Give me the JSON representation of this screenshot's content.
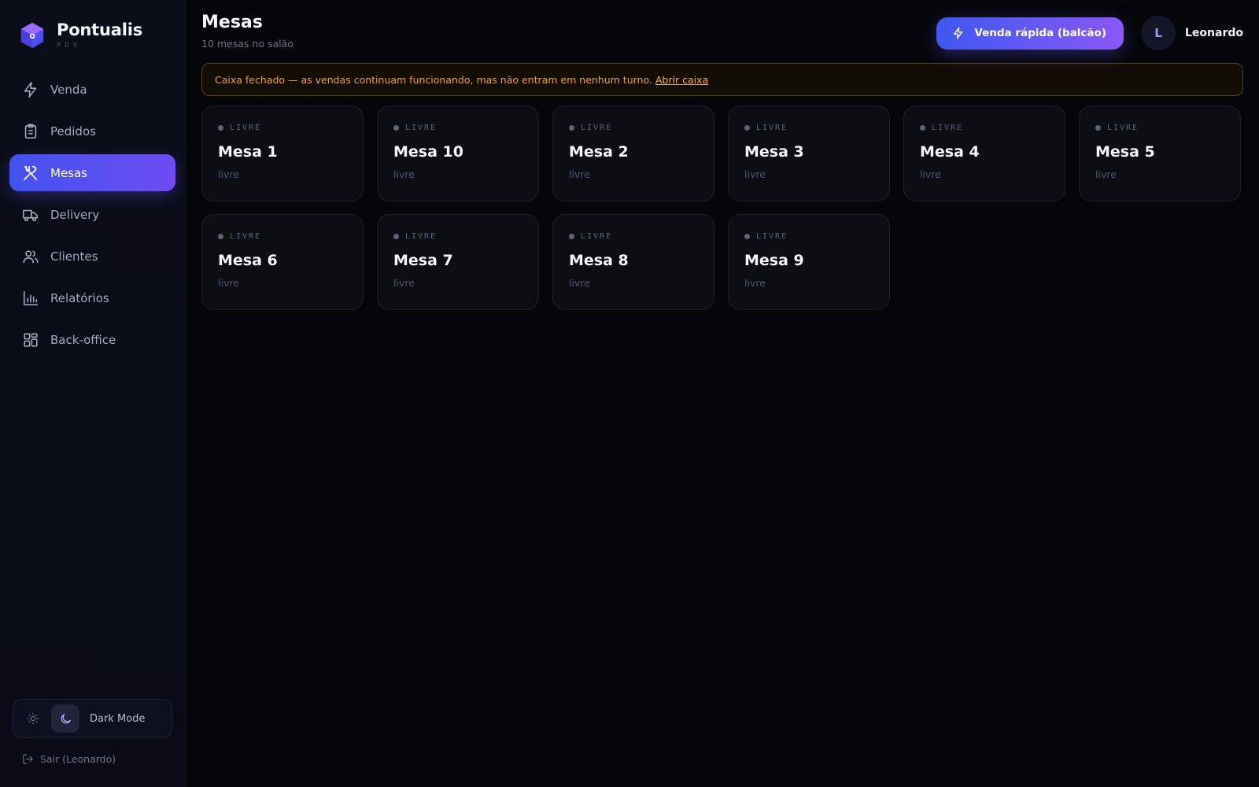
{
  "brand": {
    "name": "Pontualis",
    "subtitle": "PDV"
  },
  "nav": [
    {
      "label": "Venda",
      "icon": "bolt-icon"
    },
    {
      "label": "Pedidos",
      "icon": "clipboard-icon"
    },
    {
      "label": "Mesas",
      "icon": "utensils-icon",
      "active": true
    },
    {
      "label": "Delivery",
      "icon": "truck-icon"
    },
    {
      "label": "Clientes",
      "icon": "users-icon"
    },
    {
      "label": "Relatórios",
      "icon": "bar-chart-icon"
    },
    {
      "label": "Back-office",
      "icon": "grid-icon"
    }
  ],
  "theme_toggle": {
    "label": "Dark Mode",
    "active": "dark"
  },
  "logout": {
    "label": "Sair (Leonardo)"
  },
  "header": {
    "title": "Mesas",
    "subtitle": "10 mesas no salão"
  },
  "quick_sale": {
    "label": "Venda rápida (balcão)"
  },
  "user": {
    "initial": "L",
    "name": "Leonardo"
  },
  "alert": {
    "text": "Caixa fechado — as vendas continuam funcionando, mas não entram em nenhum turno.",
    "link": "Abrir caixa"
  },
  "tables": [
    {
      "status": "LIVRE",
      "name": "Mesa 1",
      "detail": "livre"
    },
    {
      "status": "LIVRE",
      "name": "Mesa 10",
      "detail": "livre"
    },
    {
      "status": "LIVRE",
      "name": "Mesa 2",
      "detail": "livre"
    },
    {
      "status": "LIVRE",
      "name": "Mesa 3",
      "detail": "livre"
    },
    {
      "status": "LIVRE",
      "name": "Mesa 4",
      "detail": "livre"
    },
    {
      "status": "LIVRE",
      "name": "Mesa 5",
      "detail": "livre"
    },
    {
      "status": "LIVRE",
      "name": "Mesa 6",
      "detail": "livre"
    },
    {
      "status": "LIVRE",
      "name": "Mesa 7",
      "detail": "livre"
    },
    {
      "status": "LIVRE",
      "name": "Mesa 8",
      "detail": "livre"
    },
    {
      "status": "LIVRE",
      "name": "Mesa 9",
      "detail": "livre"
    }
  ],
  "colors": {
    "accent_start": "#4352ef",
    "accent_end": "#8a58f5",
    "warning": "#f2a33a",
    "background": "#050609"
  }
}
